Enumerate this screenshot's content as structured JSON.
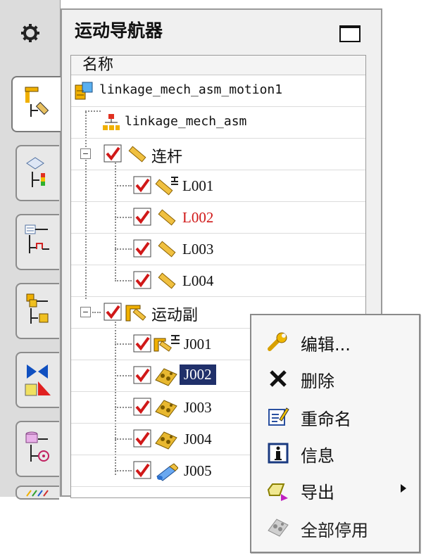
{
  "navigator": {
    "title": "运动导航器",
    "column_header": "名称",
    "rows": [
      {
        "label": "linkage_mech_asm_motion1",
        "kind": "root",
        "checked": false
      },
      {
        "label": "linkage_mech_asm",
        "kind": "assembly",
        "checked": false
      },
      {
        "label": "连杆",
        "kind": "group-links",
        "checked": true,
        "expanded": true
      },
      {
        "label": "L001",
        "kind": "link",
        "checked": true
      },
      {
        "label": "L002",
        "kind": "link",
        "checked": true,
        "color": "#d01818"
      },
      {
        "label": "L003",
        "kind": "link",
        "checked": true
      },
      {
        "label": "L004",
        "kind": "link",
        "checked": true
      },
      {
        "label": "运动副",
        "kind": "group-joints",
        "checked": true,
        "expanded": true
      },
      {
        "label": "J001",
        "kind": "joint",
        "checked": true
      },
      {
        "label": "J002",
        "kind": "joint",
        "checked": true,
        "selected": true
      },
      {
        "label": "J003",
        "kind": "joint",
        "checked": true
      },
      {
        "label": "J004",
        "kind": "joint",
        "checked": true
      },
      {
        "label": "J005",
        "kind": "joint",
        "checked": true
      }
    ]
  },
  "sidebar": {
    "tabs": [
      {
        "icon": "motion-navigator-icon",
        "active": true
      },
      {
        "icon": "analysis-navigator-icon",
        "active": false
      },
      {
        "icon": "process-navigator-icon",
        "active": false
      },
      {
        "icon": "assembly-navigator-icon",
        "active": false
      },
      {
        "icon": "constraint-navigator-icon",
        "active": false
      },
      {
        "icon": "part-navigator-icon",
        "active": false
      }
    ]
  },
  "context_menu": {
    "items": [
      {
        "label": "编辑...",
        "icon": "wrench-icon"
      },
      {
        "label": "删除",
        "icon": "delete-x-icon"
      },
      {
        "label": "重命名",
        "icon": "rename-icon"
      },
      {
        "label": "信息",
        "icon": "info-icon"
      },
      {
        "label": "导出",
        "icon": "export-icon",
        "submenu": true
      },
      {
        "label": "全部停用",
        "icon": "deactivate-all-icon"
      }
    ]
  },
  "colors": {
    "selection": "#20306a",
    "check": "#d01818",
    "highlight_text": "#d01818"
  }
}
